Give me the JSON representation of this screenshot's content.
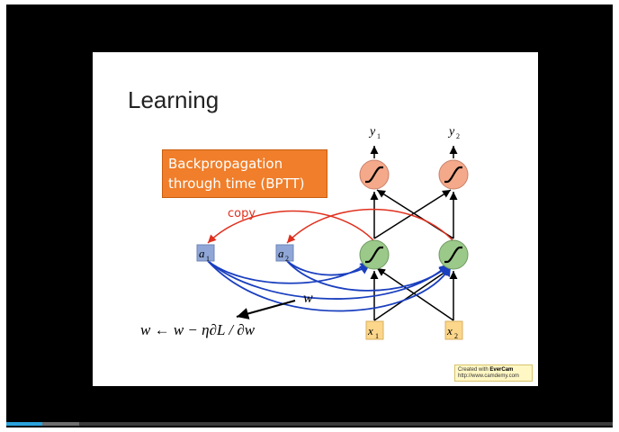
{
  "slide": {
    "title": "Learning",
    "box_line1": "Backpropagation",
    "box_line2": "through time (BPTT)",
    "copy_label": "copy",
    "a1": "a",
    "a1_sub": "1",
    "a2": "a",
    "a2_sub": "2",
    "x1": "x",
    "x1_sub": "1",
    "x2": "x",
    "x2_sub": "2",
    "y1": "y",
    "y1_sub": "1",
    "y2": "y",
    "y2_sub": "2",
    "w_label": "w",
    "update_rule": "w ← w − η∂L / ∂w"
  },
  "watermark": {
    "line1_prefix": "Created with ",
    "line1_brand": "EverCam",
    "line2": "http://www.camdemy.com"
  },
  "player": {
    "progress": 0.06,
    "buffered": 0.12
  },
  "colors": {
    "sigmoid_output": "#f4a98a",
    "sigmoid_hidden": "#9bc98a",
    "memory_cell": "#8fa6d6",
    "input_box": "#fcd68a",
    "copy_arrow": "#e0301e",
    "weight_arrow": "#1a3fbf",
    "bptt_box": "#f07e2a"
  }
}
